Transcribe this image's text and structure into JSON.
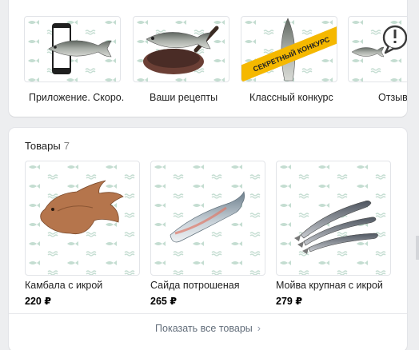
{
  "albums": {
    "items": [
      {
        "label": "Приложение. Скоро.",
        "icon": "phone-fish-icon"
      },
      {
        "label": "Ваши рецепты",
        "icon": "fish-in-pan-icon"
      },
      {
        "label": "Классный конкурс",
        "icon": "contest-fish-icon",
        "ribbon": "СЕКРЕТНЫЙ КОНКУРС"
      },
      {
        "label": "Отзывы",
        "icon": "feedback-fish-icon"
      }
    ]
  },
  "goods": {
    "title": "Товары",
    "count": "7",
    "items": [
      {
        "name": "Камбала с икрой",
        "price": "220 ₽",
        "icon": "flounder-icon"
      },
      {
        "name": "Сайда потрошеная",
        "price": "265 ₽",
        "icon": "saithe-icon"
      },
      {
        "name": "Мойва крупная с икрой",
        "price": "279 ₽",
        "icon": "capelin-icon"
      }
    ],
    "show_all": "Показать все товары"
  },
  "colors": {
    "pattern": "#bfd9cc",
    "accent_yellow": "#f5b800",
    "link": "#626d7a"
  }
}
